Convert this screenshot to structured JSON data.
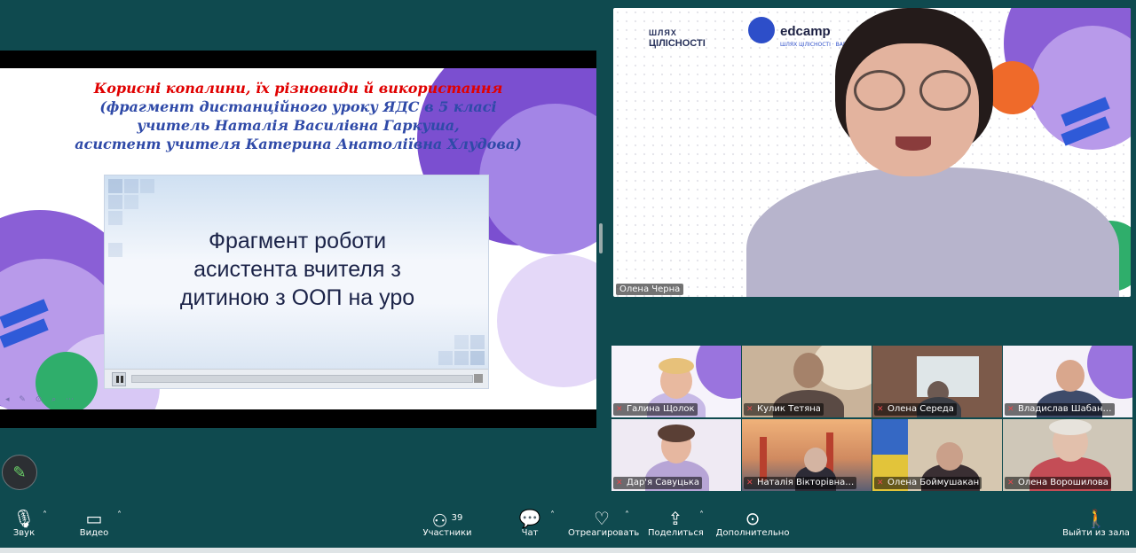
{
  "slide": {
    "title_line1": "Корисні копалини, їх різновиди й використання",
    "title_line2": "(фрагмент дистанційного уроку ЯДС в 5 класі",
    "title_line3": "учитель Наталія Василівна Гаркуша,",
    "title_line4": "асистент учителя Катерина Анатоліївна Хлудова)",
    "video_text_line1": "Фрагмент роботи",
    "video_text_line2": "асистента вчителя з",
    "video_text_line3": "дитиною з ООП на уро",
    "title_color": "#e00000",
    "subtitle_color": "#2f4aa8"
  },
  "speaker": {
    "name": "Олена Черна",
    "logo_left_line1": "ШЛЯХ",
    "logo_left_line2": "ЦІЛІСНОСТІ",
    "logo_right": "edcamp",
    "logo_right_sub": "ШЛЯХ ЦІЛІСНОСТІ · BARVINKOVE"
  },
  "participants": [
    {
      "name": "Галина Щолок"
    },
    {
      "name": "Кулик Тетяна"
    },
    {
      "name": "Олена Середа"
    },
    {
      "name": "Владислав Шабан…"
    },
    {
      "name": "Дар'я Савуцька"
    },
    {
      "name": "Наталія Вікторівна…"
    },
    {
      "name": "Олена Боймушакан"
    },
    {
      "name": "Олена Ворошилова"
    }
  ],
  "toolbar": {
    "sound": "Звук",
    "video": "Видео",
    "participants": "Участники",
    "participants_count": "39",
    "chat": "Чат",
    "react": "Отреагировать",
    "share": "Поделиться",
    "more": "Дополнительно",
    "leave": "Выйти из зала"
  },
  "icons": {
    "mic": "mic-muted-icon",
    "camera": "camera-icon",
    "people": "participants-icon",
    "chat": "chat-icon",
    "heart": "react-icon",
    "share": "share-screen-icon",
    "more": "more-icon",
    "leave": "leave-icon",
    "pen": "pen-icon"
  }
}
